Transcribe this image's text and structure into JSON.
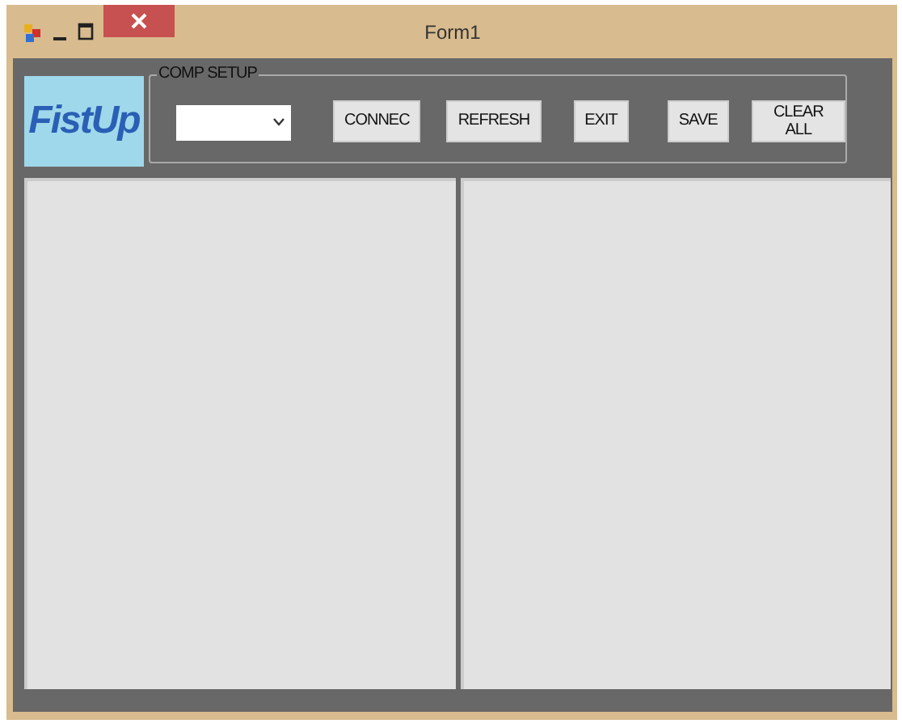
{
  "window": {
    "title": "Form1"
  },
  "logo": {
    "text": "FistUp"
  },
  "group": {
    "title": "COMP SETUP"
  },
  "buttons": [
    "CONNEC",
    "REFRESH",
    "EXIT",
    "SAVE",
    "CLEAR ALL"
  ],
  "panels": [
    {
      "kind": "panel"
    },
    {
      "kind": "panel"
    }
  ]
}
